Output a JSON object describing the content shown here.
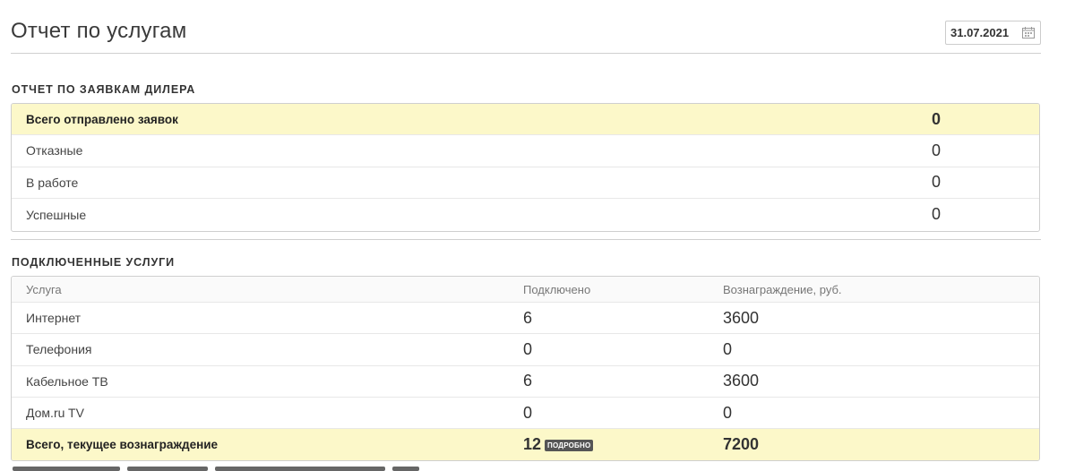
{
  "page": {
    "title": "Отчет по услугам"
  },
  "date_filter": {
    "value": "31.07.2021",
    "icon": "calendar-icon"
  },
  "dealer_requests": {
    "title": "ОТЧЕТ ПО ЗАЯВКАМ ДИЛЕРА",
    "rows": [
      {
        "label": "Всего отправлено заявок",
        "value": "0"
      },
      {
        "label": "Отказные",
        "value": "0"
      },
      {
        "label": "В работе",
        "value": "0"
      },
      {
        "label": "Успешные",
        "value": "0"
      }
    ]
  },
  "connected_services": {
    "title": "ПОДКЛЮЧЕННЫЕ УСЛУГИ",
    "columns": [
      "Услуга",
      "Подключено",
      "Вознаграждение, руб."
    ],
    "rows": [
      {
        "service": "Интернет",
        "connected": "6",
        "reward": "3600"
      },
      {
        "service": "Телефония",
        "connected": "0",
        "reward": "0"
      },
      {
        "service": "Кабельное ТВ",
        "connected": "6",
        "reward": "3600"
      },
      {
        "service": "Дом.ru TV",
        "connected": "0",
        "reward": "0"
      }
    ],
    "total": {
      "label": "Всего, текущее вознаграждение",
      "connected": "12",
      "details_label": "ПОДРОБНО",
      "reward": "7200"
    }
  },
  "colors": {
    "highlight_row": "#fcf8c9",
    "border": "#cfcfcf",
    "badge": "#555555"
  }
}
